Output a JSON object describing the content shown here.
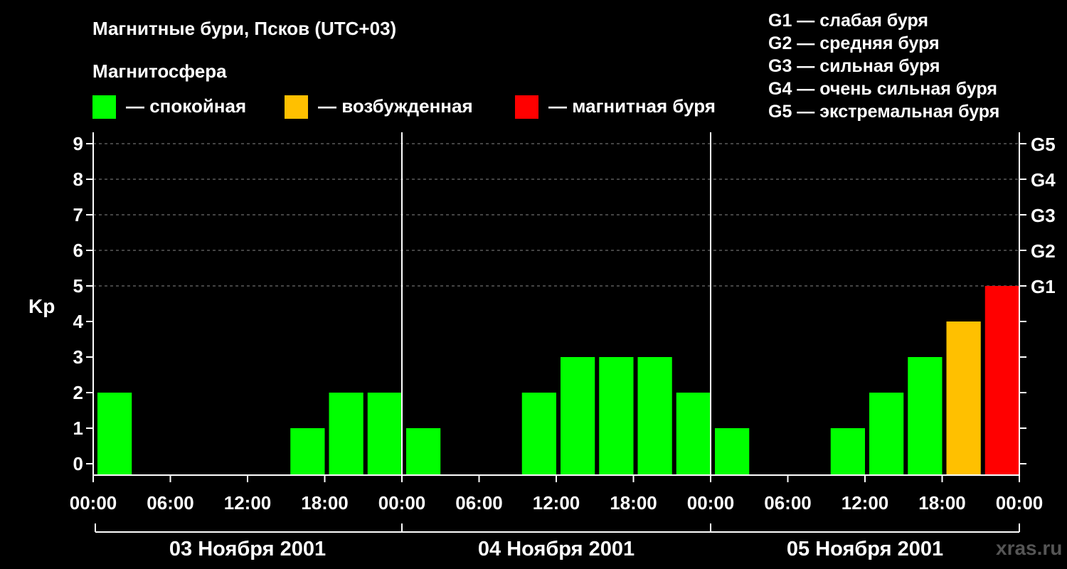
{
  "title": "Магнитные бури, Псков (UTC+03)",
  "subtitle": "Магнитосфера",
  "colors": {
    "calm": "#00ff00",
    "excited": "#ffc000",
    "storm": "#ff0000",
    "background": "#000000",
    "text": "#ffffff",
    "grid": "#888888"
  },
  "legend": [
    {
      "label": "— спокойная",
      "color_key": "calm"
    },
    {
      "label": "— возбужденная",
      "color_key": "excited"
    },
    {
      "label": "— магнитная буря",
      "color_key": "storm"
    }
  ],
  "g_legend": [
    "G1 — слабая буря",
    "G2 — средняя буря",
    "G3 — сильная буря",
    "G4 — очень сильная буря",
    "G5 — экстремальная буря"
  ],
  "watermark": "xras.ru",
  "chart_data": {
    "type": "bar",
    "title": "Магнитные бури, Псков (UTC+03)",
    "ylabel": "Kp",
    "ylim": [
      0,
      9
    ],
    "yticks": [
      "0",
      "1",
      "2",
      "3",
      "4",
      "5",
      "6",
      "7",
      "8",
      "9"
    ],
    "right_ticks": [
      {
        "kp": 5,
        "label": "G1"
      },
      {
        "kp": 6,
        "label": "G2"
      },
      {
        "kp": 7,
        "label": "G3"
      },
      {
        "kp": 8,
        "label": "G4"
      },
      {
        "kp": 9,
        "label": "G5"
      }
    ],
    "xticks": [
      "00:00",
      "06:00",
      "12:00",
      "18:00",
      "00:00",
      "06:00",
      "12:00",
      "18:00",
      "00:00",
      "06:00",
      "12:00",
      "18:00",
      "00:00"
    ],
    "dates": [
      "03 Ноября 2001",
      "04 Ноября 2001",
      "05 Ноября 2001"
    ],
    "interval_hours": 3,
    "values": [
      2,
      0,
      0,
      0,
      0,
      1,
      2,
      2,
      1,
      0,
      0,
      2,
      3,
      3,
      3,
      2,
      1,
      0,
      0,
      1,
      2,
      3,
      4,
      5
    ],
    "grid": true
  }
}
